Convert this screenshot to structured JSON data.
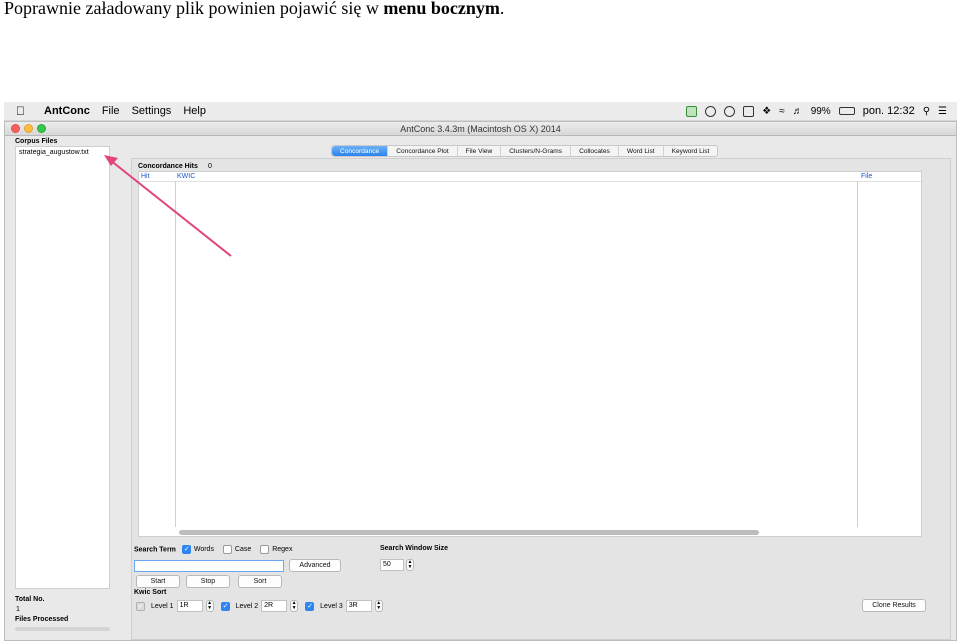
{
  "caption": {
    "text_before": "Poprawnie załadowany plik powinien pojawić się w ",
    "bold": "menu bocznym",
    "text_after": "."
  },
  "menubar": {
    "app_name": "AntConc",
    "menu_items": [
      "File",
      "Settings",
      "Help"
    ],
    "battery": "99%",
    "clock": "pon. 12:32"
  },
  "window": {
    "title": "AntConc 3.4.3m (Macintosh OS X) 2014"
  },
  "sidebar": {
    "header": "Corpus Files",
    "files": [
      "strategia_augustow.txt"
    ],
    "total_label": "Total No.",
    "total_value": "1",
    "files_processed_label": "Files Processed"
  },
  "tabs": [
    {
      "label": "Concordance",
      "active": true
    },
    {
      "label": "Concordance Plot",
      "active": false
    },
    {
      "label": "File View",
      "active": false
    },
    {
      "label": "Clusters/N-Grams",
      "active": false
    },
    {
      "label": "Collocates",
      "active": false
    },
    {
      "label": "Word List",
      "active": false
    },
    {
      "label": "Keyword List",
      "active": false
    }
  ],
  "concordance": {
    "hits_label": "Concordance Hits",
    "hits_value": "0",
    "columns": {
      "hit": "Hit",
      "kwic": "KWIC",
      "file": "File"
    }
  },
  "search": {
    "term_label": "Search Term",
    "options": {
      "words": "Words",
      "case": "Case",
      "regex": "Regex"
    },
    "input_value": "",
    "advanced_label": "Advanced",
    "window_size_label": "Search Window Size",
    "window_size_value": "50",
    "start_label": "Start",
    "stop_label": "Stop",
    "sort_label": "Sort"
  },
  "kwic_sort": {
    "label": "Kwic Sort",
    "level1_label": "Level 1",
    "level1_value": "1R",
    "level2_label": "Level 2",
    "level2_value": "2R",
    "level3_label": "Level 3",
    "level3_value": "3R",
    "clone_label": "Clone Results"
  },
  "colors": {
    "accent": "#2f86f0",
    "arrow": "#e0457b",
    "column_header": "#2255cc"
  }
}
